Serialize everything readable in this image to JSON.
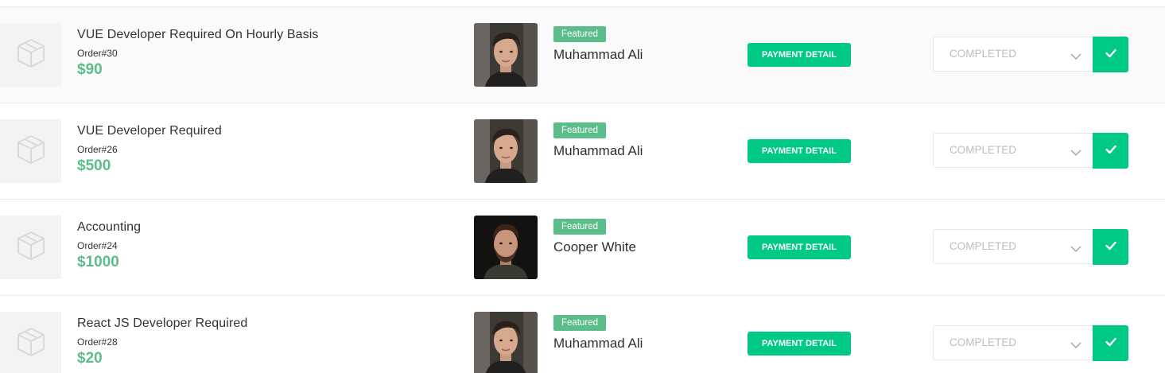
{
  "colors": {
    "accent": "#00c988",
    "featured_badge": "#5bbd8a",
    "price": "#5bbd8a",
    "row_alt_background": "#fafafa"
  },
  "orders": [
    {
      "title": "VUE Developer Required On Hourly Basis",
      "order_number": "Order#30",
      "price": "$90",
      "badge": "Featured",
      "seller_name": "Muhammad Ali",
      "avatar": "young-man-photo",
      "payment_button": "PAYMENT DETAIL",
      "status": "COMPLETED",
      "thumbnail_icon": "package-icon",
      "confirm_icon": "checkmark-icon"
    },
    {
      "title": "VUE Developer Required",
      "order_number": "Order#26",
      "price": "$500",
      "badge": "Featured",
      "seller_name": "Muhammad Ali",
      "avatar": "young-man-photo",
      "payment_button": "PAYMENT DETAIL",
      "status": "COMPLETED",
      "thumbnail_icon": "package-icon",
      "confirm_icon": "checkmark-icon"
    },
    {
      "title": "Accounting",
      "order_number": "Order#24",
      "price": "$1000",
      "badge": "Featured",
      "seller_name": "Cooper White",
      "avatar": "bearded-man-photo",
      "payment_button": "PAYMENT DETAIL",
      "status": "COMPLETED",
      "thumbnail_icon": "package-icon",
      "confirm_icon": "checkmark-icon"
    },
    {
      "title": "React JS Developer Required",
      "order_number": "Order#28",
      "price": "$20",
      "badge": "Featured",
      "seller_name": "Muhammad Ali",
      "avatar": "young-man-photo",
      "payment_button": "PAYMENT DETAIL",
      "status": "COMPLETED",
      "thumbnail_icon": "package-icon",
      "confirm_icon": "checkmark-icon"
    }
  ]
}
